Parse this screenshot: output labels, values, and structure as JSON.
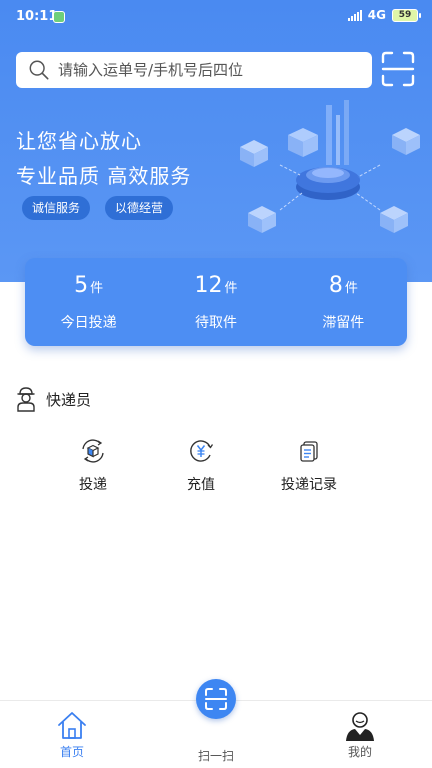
{
  "status_bar": {
    "time": "10:11",
    "network": "4G",
    "battery": "59"
  },
  "search": {
    "placeholder": "请输入运单号/手机号后四位"
  },
  "banner": {
    "slogan_line1": "让您省心放心",
    "slogan_line2": "专业品质 高效服务",
    "tags": [
      "诚信服务",
      "以德经营"
    ]
  },
  "stats": [
    {
      "value": "5",
      "unit": "件",
      "label": "今日投递"
    },
    {
      "value": "12",
      "unit": "件",
      "label": "待取件"
    },
    {
      "value": "8",
      "unit": "件",
      "label": "滞留件"
    }
  ],
  "courier_section": {
    "title": "快递员",
    "actions": [
      {
        "label": "投递",
        "icon": "package-delivery-icon"
      },
      {
        "label": "充值",
        "icon": "yuan-recharge-icon"
      },
      {
        "label": "投递记录",
        "icon": "document-record-icon"
      }
    ]
  },
  "tabbar": {
    "items": [
      {
        "label": "首页",
        "icon": "home-icon",
        "active": true
      },
      {
        "label": "扫一扫",
        "icon": "scan-icon",
        "active": false
      },
      {
        "label": "我的",
        "icon": "user-profile-icon",
        "active": false
      }
    ]
  },
  "colors": {
    "primary": "#4f8ff2",
    "tag_bg": "#2f6fd6",
    "active_tab": "#3a7ff0"
  }
}
